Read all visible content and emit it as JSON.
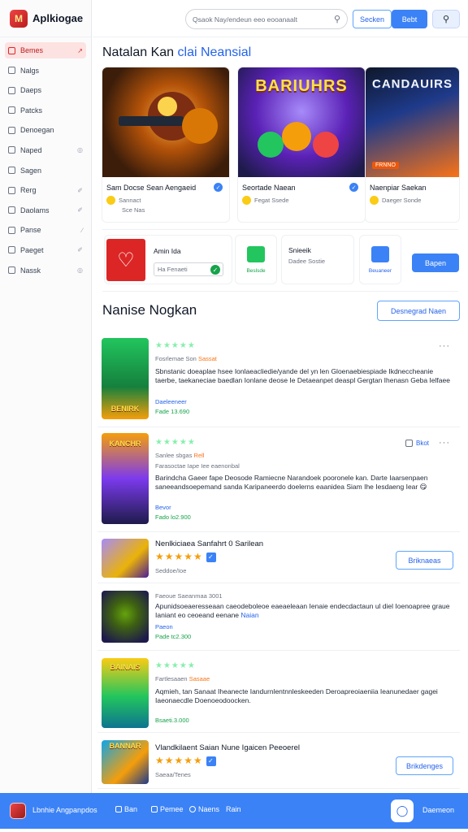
{
  "app": {
    "name": "Aplkiogae"
  },
  "sidebar": {
    "items": [
      {
        "label": "Bemes",
        "tail": "↗",
        "active": true
      },
      {
        "label": "Nalgs",
        "tail": ""
      },
      {
        "label": "Daeps",
        "tail": ""
      },
      {
        "label": "Patcks",
        "tail": ""
      },
      {
        "label": "Denoegan",
        "tail": ""
      },
      {
        "label": "Naped",
        "tail": "◎"
      },
      {
        "label": "Sagen",
        "tail": ""
      },
      {
        "label": "Rerg",
        "tail": "✐"
      },
      {
        "label": "Daolams",
        "tail": "✐"
      },
      {
        "label": "Panse",
        "tail": "∕"
      },
      {
        "label": "Paeget",
        "tail": "✐"
      },
      {
        "label": "Nassk",
        "tail": "◎"
      }
    ]
  },
  "topbar": {
    "search_placeholder": "Qsaok Nay/endeun eeo eooanaalt",
    "btn_outline": "Secken",
    "btn_solid": "Bebt"
  },
  "featured": {
    "title_prefix": "Natalan Kan",
    "title_accent": "clai Neansial",
    "cards": [
      {
        "caption": "",
        "tag": "",
        "title": "Sam Docse Sean Aengaeid",
        "meta": "Sannact",
        "meta2": "Sce Nas"
      },
      {
        "caption": "BARIUHRS",
        "tag": "",
        "title": "Seortade Naean",
        "meta": "Fegat Ssede",
        "meta2": ""
      },
      {
        "caption": "CANDAUIRS",
        "tag": "FRNNO",
        "title": "Naenpiar Saekan",
        "meta": "Daeger Sonde",
        "meta2": ""
      }
    ]
  },
  "promos": {
    "p1_label": "Amin Ida",
    "p1_field": "Ha Fenaeti",
    "p2_caption": "Beslsde",
    "p3_title": "Snieeik",
    "p3_sub": "Dadee Sostie",
    "p4_caption": "Beuaneer",
    "button": "Bapen"
  },
  "section": {
    "title": "Nanise Nogkan",
    "button": "Desnegrad Naen"
  },
  "posts": [
    {
      "thumb_label": "BENIRK",
      "meta": "Fosrlemae Son",
      "meta_hot": "Sassat",
      "body": "Sbnstanic doeaplae hsee Ionlaeacliedie/yande del yn len Gloenaebiespiade Ikdneccheanie taerbe, taekaneciae baedlan Ionlane deose Ie Detaeanpet deaspl Gergtan Ihenasn Geba Ielfaee",
      "link": "Daeleeneer",
      "price": "Fade 13.690",
      "more": "···"
    },
    {
      "thumb_label": "KANCHR",
      "meta": "Sanlee sbgas",
      "meta_hot": "Rell",
      "meta2": "Farasoctae Iape Iee eaenonbal",
      "body": "Barindcha Gaeer fape Deosode Ramiecne Narandoek pooronele kan. Darte Iaarsenpaen saneeandsoepemand sanda Karipaneerdo doelerns eaanidea Siam Ihe Iesdaeng Iear 😋",
      "link": "Bevor",
      "price": "Fado lo2.900",
      "action": "Bkot",
      "more": "···"
    },
    {
      "title": "Nenlkiciaea Sanfahrt 0 Sarilean",
      "meta": "Seddoe/Ioe",
      "button": "Briknaeas"
    },
    {
      "meta": "Faeoue Saeanmaa 3001",
      "body": "Apunidsoeaeresseaan caeodeboleoe eaeaeleaan Ienaie endecdactaun ul diel Ioenoapree graue Ianiant eo ceoeand eenane",
      "body_link": "Naian",
      "link": "Paeon",
      "price": "Pade tc2.300"
    },
    {
      "thumb_label": "BAINAIS",
      "meta": "Fartlesaaen",
      "meta_hot": "Sasaae",
      "body": "Aqmieh, tan Sanaat Iheanecte Iandurnlentnnleskeeden Deroapreoiaeniia Ieanunedaer gagei Iaeonaecdle Doenoeodoocken.",
      "price": "Bsaeti.3.000"
    },
    {
      "thumb_label": "BANNAR",
      "title": "Vlandkilaent Saian Nune Igaicen Peeoerel",
      "meta": "Saeaa/Tenes",
      "button": "Brikdenges"
    }
  ],
  "bottombar": {
    "title": "Lbnhie Angpanpdos",
    "items": [
      "Ban",
      "Pemee",
      "Naens",
      "Rain"
    ],
    "right": "Daemeon"
  }
}
